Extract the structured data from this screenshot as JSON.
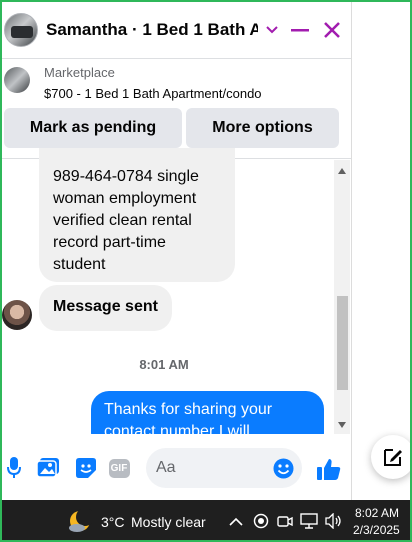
{
  "header": {
    "title": "Samantha · 1 Bed 1 Bath A...",
    "accent": "#a21caf"
  },
  "marketplace": {
    "label": "Marketplace",
    "listing": "$700 - 1 Bed 1 Bath Apartment/condo"
  },
  "actions": {
    "pending_label": "Mark as pending",
    "more_label": "More options"
  },
  "messages": {
    "incoming_1": [
      "989-464-0784 single",
      "woman employment",
      "verified clean rental",
      "record part-time",
      "student"
    ],
    "incoming_2": "Message sent",
    "timestamp": "8:01 AM",
    "outgoing_1": [
      "Thanks for sharing your",
      "contact number I will"
    ]
  },
  "composer": {
    "placeholder": "Aa",
    "icons": [
      "microphone-icon",
      "image-icon",
      "sticker-icon",
      "gif-icon",
      "emoji-icon",
      "thumbs-up-icon"
    ],
    "gif_text": "GIF"
  },
  "taskbar": {
    "temperature": "3°C",
    "weather": "Mostly clear",
    "time": "8:02 AM",
    "date": "2/3/2025"
  }
}
